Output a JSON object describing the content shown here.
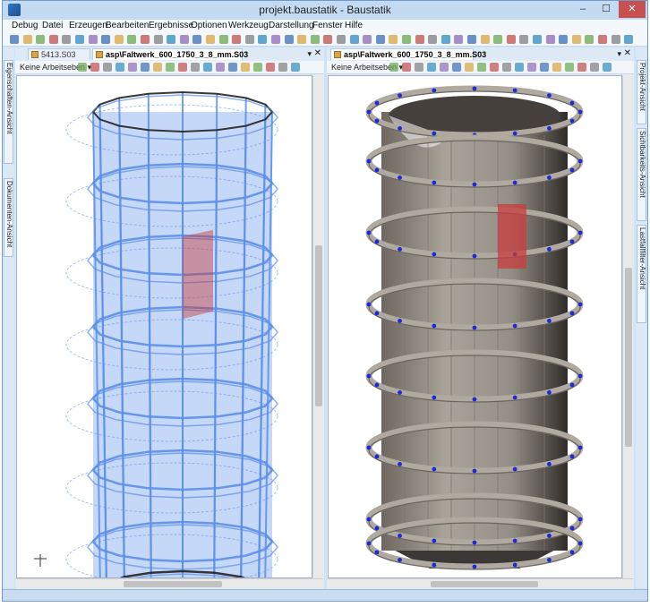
{
  "window": {
    "title": "projekt.baustatik - Baustatik",
    "minimize": "–",
    "maximize": "☐",
    "close": "✕"
  },
  "menu": [
    "Debug",
    "Datei",
    "Erzeugen",
    "Bearbeiten",
    "Ergebnisse",
    "Optionen",
    "Werkzeug",
    "Darstellung",
    "Fenster",
    "Hilfe"
  ],
  "left_sidebar": {
    "tabs": [
      "Eigenschaften-Ansicht",
      "Dokumenten-Ansicht"
    ]
  },
  "right_sidebar": {
    "tabs": [
      "Projekt-Ansicht",
      "Sichtbarkeits-Ansicht",
      "Lastfallfilter-Ansicht"
    ]
  },
  "left_pane": {
    "tabs": [
      "5413.S03",
      "asp\\Faltwerk_600_1750_3_8_mm.S03"
    ],
    "active_tab": 1,
    "workplane_select": "Keine Arbeitseben",
    "render_mode": "wireframe"
  },
  "right_pane": {
    "tabs": [
      "asp\\Faltwerk_600_1750_3_8_mm.S03"
    ],
    "active_tab": 0,
    "workplane_select": "Keine Arbeitseben",
    "render_mode": "solid"
  },
  "colors": {
    "wire_blue": "#5b8fe8",
    "highlight_red": "#c83c3c",
    "concrete": "#9c958d",
    "node_blue": "#1a2bd9"
  }
}
